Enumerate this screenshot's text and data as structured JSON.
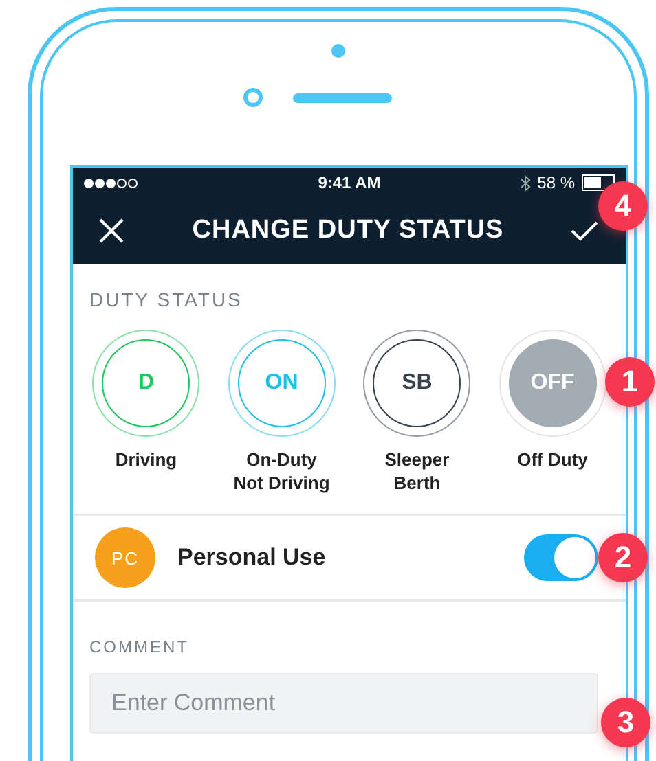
{
  "status_bar": {
    "time": "9:41 AM",
    "battery": "58 %"
  },
  "header": {
    "title": "CHANGE DUTY STATUS",
    "confirm_badge": "4"
  },
  "duty_status": {
    "heading": "DUTY STATUS",
    "badge": "1",
    "options": [
      {
        "code": "D",
        "label": "Driving",
        "color": "#22c55e",
        "selected": false
      },
      {
        "code": "ON",
        "label": "On-Duty\nNot Driving",
        "color": "#1ec0ea",
        "selected": false
      },
      {
        "code": "SB",
        "label": "Sleeper\nBerth",
        "color": "#3b4250",
        "selected": false
      },
      {
        "code": "OFF",
        "label": "Off Duty",
        "color": "#a3abb5",
        "selected": true
      }
    ]
  },
  "personal_use": {
    "icon_text": "PC",
    "label": "Personal Use",
    "on": true,
    "badge": "2"
  },
  "comment": {
    "heading": "COMMENT",
    "placeholder": "Enter Comment",
    "badge": "3"
  }
}
